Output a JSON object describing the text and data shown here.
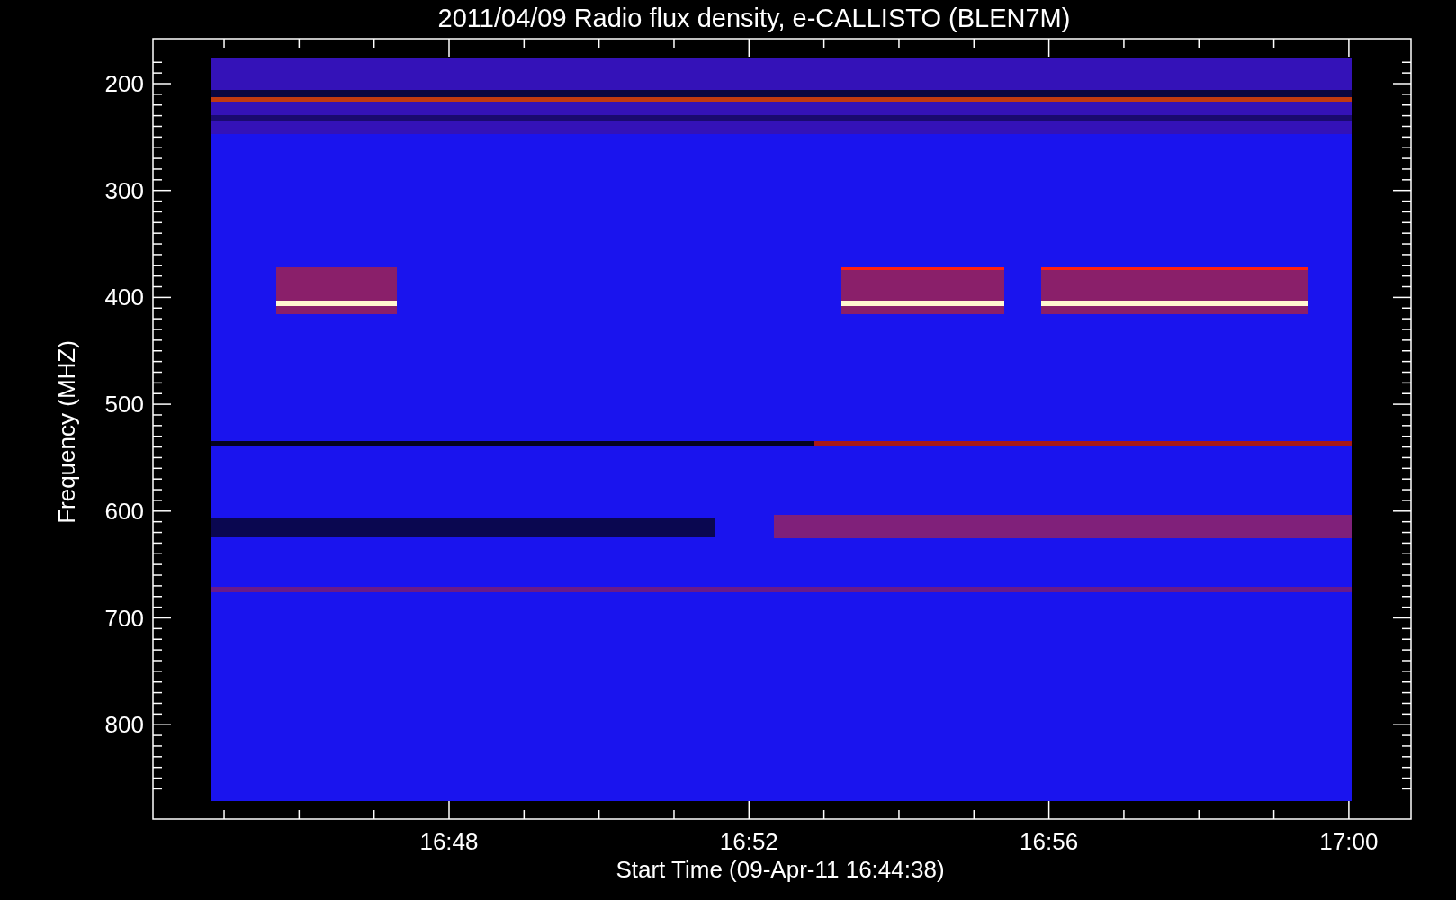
{
  "title": "2011/04/09  Radio flux density, e-CALLISTO (BLEN7M)",
  "y_axis": {
    "label": "Frequency (MHZ)",
    "ticks": [
      "200",
      "300",
      "400",
      "500",
      "600",
      "700",
      "800"
    ]
  },
  "x_axis": {
    "label": "Start Time (09-Apr-11 16:44:38)",
    "ticks": [
      "16:48",
      "16:52",
      "16:56",
      "17:00"
    ]
  }
}
